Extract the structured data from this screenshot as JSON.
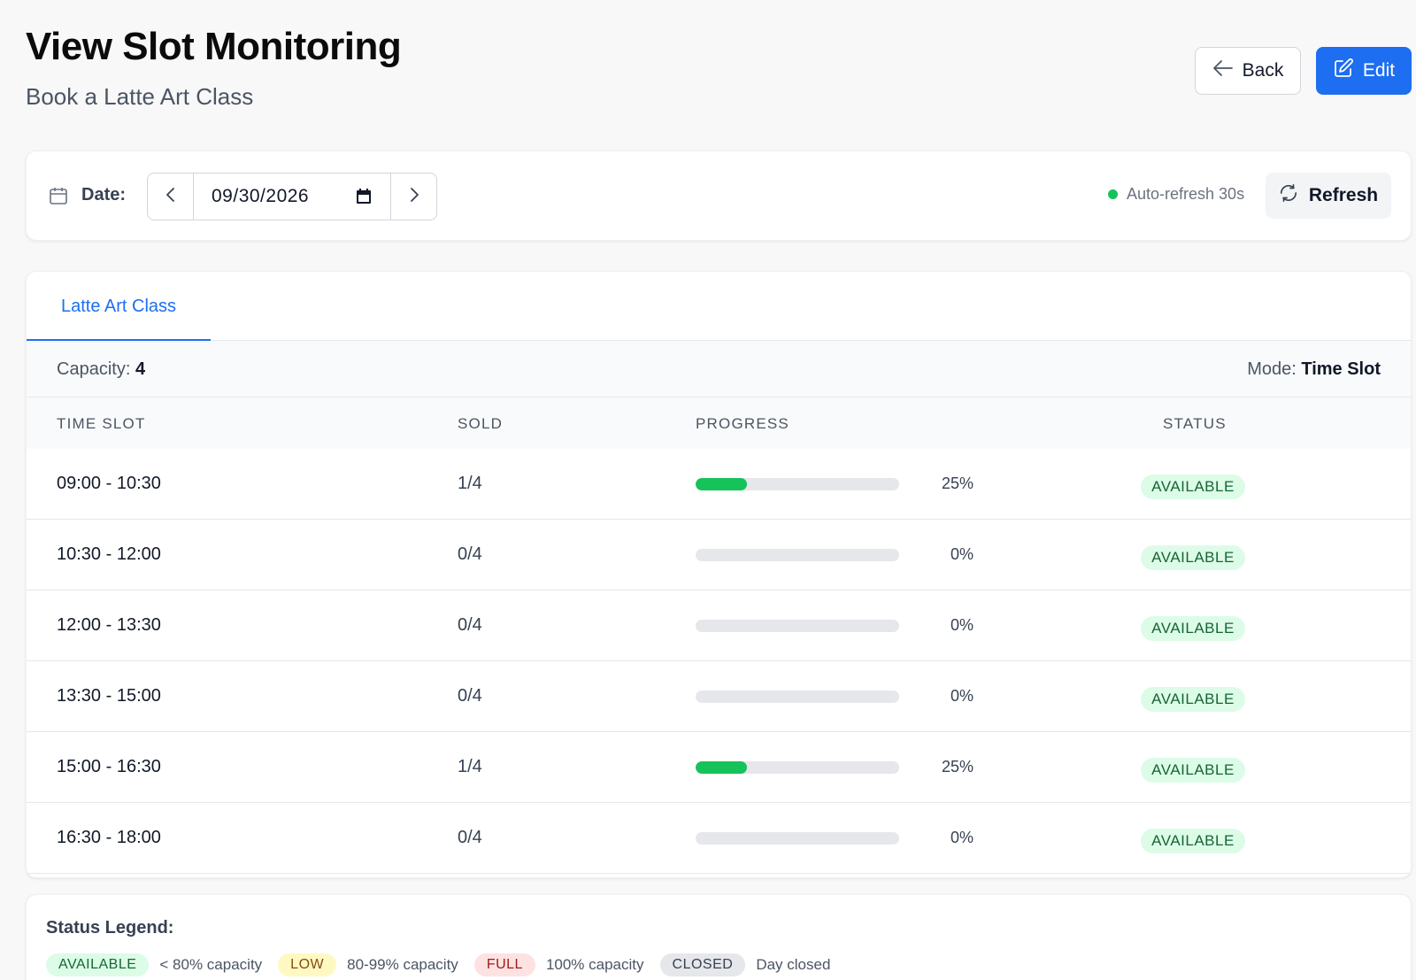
{
  "header": {
    "title": "View Slot Monitoring",
    "subtitle": "Book a Latte Art Class",
    "back_label": "Back",
    "edit_label": "Edit"
  },
  "date_bar": {
    "label": "Date:",
    "value": "09/30/2026",
    "auto_refresh": "Auto-refresh 30s",
    "refresh_label": "Refresh"
  },
  "tabs": [
    {
      "label": "Latte Art Class",
      "active": true
    }
  ],
  "info": {
    "capacity_label": "Capacity:",
    "capacity_value": "4",
    "mode_label": "Mode:",
    "mode_value": "Time Slot"
  },
  "table": {
    "headers": [
      "TIME SLOT",
      "SOLD",
      "PROGRESS",
      "STATUS"
    ],
    "rows": [
      {
        "time": "09:00 - 10:30",
        "sold": "1/4",
        "progress": 25,
        "pct": "25%",
        "status": "AVAILABLE"
      },
      {
        "time": "10:30 - 12:00",
        "sold": "0/4",
        "progress": 0,
        "pct": "0%",
        "status": "AVAILABLE"
      },
      {
        "time": "12:00 - 13:30",
        "sold": "0/4",
        "progress": 0,
        "pct": "0%",
        "status": "AVAILABLE"
      },
      {
        "time": "13:30 - 15:00",
        "sold": "0/4",
        "progress": 0,
        "pct": "0%",
        "status": "AVAILABLE"
      },
      {
        "time": "15:00 - 16:30",
        "sold": "1/4",
        "progress": 25,
        "pct": "25%",
        "status": "AVAILABLE"
      },
      {
        "time": "16:30 - 18:00",
        "sold": "0/4",
        "progress": 0,
        "pct": "0%",
        "status": "AVAILABLE"
      }
    ]
  },
  "legend": {
    "title": "Status Legend:",
    "items": [
      {
        "badge": "AVAILABLE",
        "desc": "< 80% capacity",
        "bg": "#dcfce7",
        "fg": "#166534"
      },
      {
        "badge": "LOW",
        "desc": "80-99% capacity",
        "bg": "#fef9c3",
        "fg": "#854d0e"
      },
      {
        "badge": "FULL",
        "desc": "100% capacity",
        "bg": "#fee2e2",
        "fg": "#991b1b"
      },
      {
        "badge": "CLOSED",
        "desc": "Day closed",
        "bg": "#e5e7eb",
        "fg": "#374151"
      }
    ]
  },
  "colors": {
    "accent": "#1d6ef0",
    "progress_fill": "#16c25a",
    "live_dot": "#16c25a"
  }
}
